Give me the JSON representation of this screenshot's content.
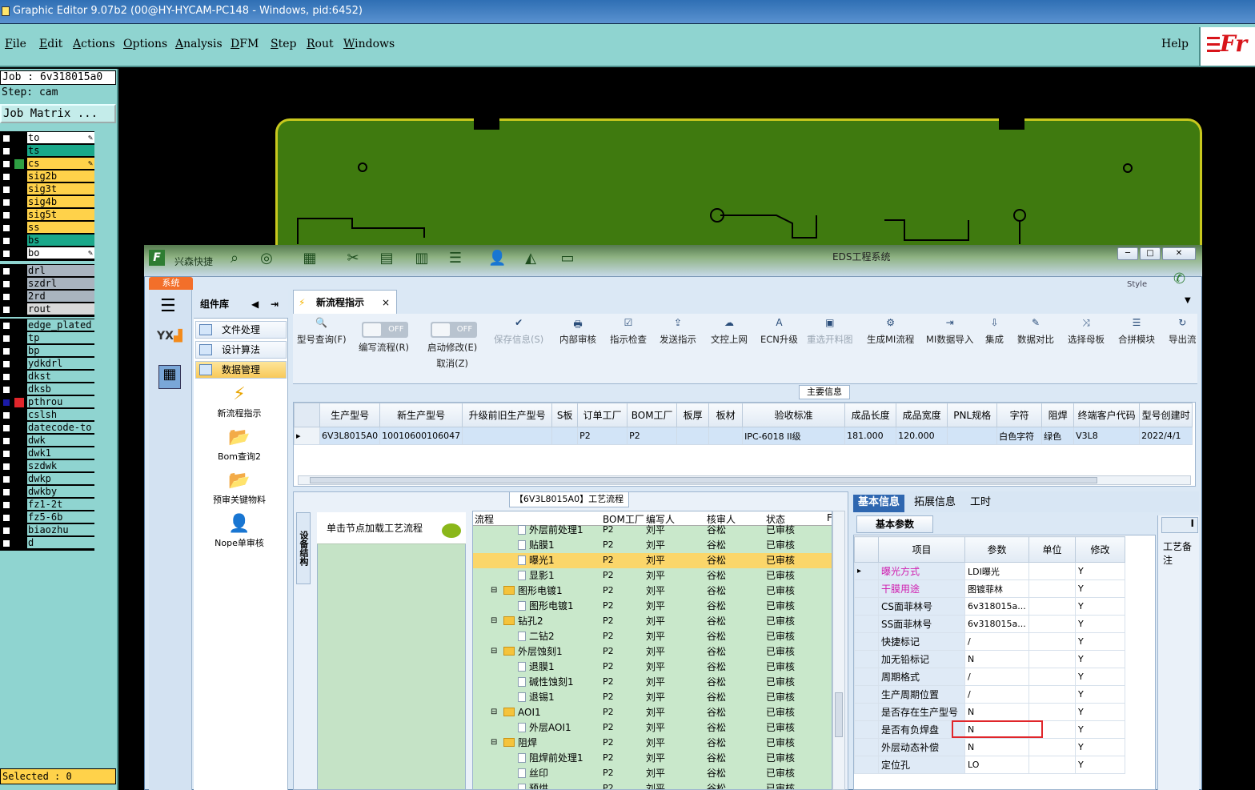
{
  "window": {
    "title": "Graphic Editor 9.07b2 (00@HY-HYCAM-PC148 - Windows, pid:6452)"
  },
  "menu": {
    "items": [
      "File",
      "Edit",
      "Actions",
      "Options",
      "Analysis",
      "DFM",
      "Step",
      "Rout",
      "Windows"
    ],
    "help": "Help",
    "logo": "Fr"
  },
  "left": {
    "job": "Job : 6v318015a0",
    "step": "Step: cam",
    "matrix_button": "Job Matrix ...",
    "layers_group1": [
      {
        "name": "to",
        "color": "#ffffff",
        "pen": true
      },
      {
        "name": "ts",
        "color": "#1aa88a"
      },
      {
        "name": "cs",
        "color": "#ffd24a",
        "pen": true,
        "mark": "#2ea043"
      },
      {
        "name": "sig2b",
        "color": "#ffd24a"
      },
      {
        "name": "sig3t",
        "color": "#ffd24a"
      },
      {
        "name": "sig4b",
        "color": "#ffd24a"
      },
      {
        "name": "sig5t",
        "color": "#ffd24a"
      },
      {
        "name": "ss",
        "color": "#ffd24a"
      },
      {
        "name": "bs",
        "color": "#1aa88a"
      },
      {
        "name": "bo",
        "color": "#ffffff",
        "pen": true
      }
    ],
    "layers_group2": [
      {
        "name": "drl",
        "color": "#a9b4bf"
      },
      {
        "name": "szdrl",
        "color": "#a9b4bf"
      },
      {
        "name": "2rd",
        "color": "#a9b4bf"
      },
      {
        "name": "rout",
        "color": "#d9d9d9"
      }
    ],
    "layers_group3": [
      {
        "name": "edge_plated",
        "color": "#8fd4d0"
      },
      {
        "name": "tp",
        "color": "#8fd4d0"
      },
      {
        "name": "bp",
        "color": "#8fd4d0"
      },
      {
        "name": "ydkdrl",
        "color": "#8fd4d0"
      },
      {
        "name": "dkst",
        "color": "#8fd4d0"
      },
      {
        "name": "dksb",
        "color": "#8fd4d0"
      },
      {
        "name": "pthrou",
        "color": "#8fd4d0",
        "mark": "#e0262b",
        "sel": true
      },
      {
        "name": "cslsh",
        "color": "#8fd4d0"
      },
      {
        "name": "datecode-to",
        "color": "#8fd4d0"
      },
      {
        "name": "dwk",
        "color": "#8fd4d0"
      },
      {
        "name": "dwk1",
        "color": "#8fd4d0"
      },
      {
        "name": "szdwk",
        "color": "#8fd4d0"
      },
      {
        "name": "dwkp",
        "color": "#8fd4d0"
      },
      {
        "name": "dwkby",
        "color": "#8fd4d0"
      },
      {
        "name": "fz1-2t",
        "color": "#8fd4d0"
      },
      {
        "name": "fz5-6b",
        "color": "#8fd4d0"
      },
      {
        "name": "biaozhu",
        "color": "#8fd4d0"
      },
      {
        "name": "d",
        "color": "#8fd4d0"
      }
    ],
    "selected": "Selected : 0"
  },
  "eds": {
    "app_name": "兴森快捷",
    "title": "EDS工程系统",
    "style_label": "Style",
    "sys_tab": "系统",
    "component_lib": "组件库",
    "comp_items": [
      "文件处理",
      "设计算法",
      "数据管理"
    ],
    "tools": [
      {
        "label": "新流程指示",
        "icon": "⚡"
      },
      {
        "label": "Bom查询2",
        "icon": "📂"
      },
      {
        "label": "预审关键物料",
        "icon": "📂"
      },
      {
        "label": "Nope单审核",
        "icon": "👤"
      }
    ],
    "doc_tab": "新流程指示",
    "ribbon": [
      {
        "label": "型号查询(F)",
        "icon": "🔍"
      },
      {
        "label": "编写流程(R)",
        "toggle": "OFF"
      },
      {
        "label": "启动修改(E)",
        "label2": "取消(Z)",
        "toggle": "OFF"
      },
      {
        "label": "保存信息(S)",
        "icon": "✔",
        "disabled": true
      },
      {
        "label": "内部审核",
        "icon": "🖶"
      },
      {
        "label": "指示检查",
        "icon": "☑"
      },
      {
        "label": "发送指示",
        "icon": "⇪"
      },
      {
        "label": "文控上网",
        "icon": "☁"
      },
      {
        "label": "ECN升级",
        "icon": "A"
      },
      {
        "label": "重选开料图",
        "icon": "▣",
        "disabled": true
      },
      {
        "label": "生成MI流程",
        "icon": "⚙"
      },
      {
        "label": "MI数据导入",
        "icon": "⇥"
      },
      {
        "label": "集成",
        "icon": "⇩"
      },
      {
        "label": "数据对比",
        "icon": "✎"
      },
      {
        "label": "选择母板",
        "icon": "⤨"
      },
      {
        "label": "合拼模块",
        "icon": "☰"
      },
      {
        "label": "导出流",
        "icon": "↻"
      }
    ],
    "main_info_label": "主要信息",
    "main_table": {
      "headers": [
        "生产型号",
        "新生产型号",
        "升级前旧生产型号",
        "S板",
        "订单工厂",
        "BOM工厂",
        "板厚",
        "板材",
        "验收标准",
        "成品长度",
        "成品宽度",
        "PNL规格",
        "字符",
        "阻焊",
        "终端客户代码",
        "型号创建时"
      ],
      "row": [
        "6V3L8015A0",
        "10010600106047",
        "",
        "",
        "P2",
        "P2",
        "",
        "",
        "IPC-6018 II级",
        "181.000",
        "120.000",
        "",
        "白色字符",
        "绿色",
        "V3L8",
        "2022/4/1"
      ]
    },
    "process_title": "【6V3L8015A0】工艺流程",
    "equipment_tab": "设备结构",
    "node_hint": "单击节点加载工艺流程",
    "tree_headers": [
      "流程",
      "BOM工厂",
      "编写人",
      "核审人",
      "状态",
      "F"
    ],
    "tree_rows": [
      {
        "name": "外层前处理1",
        "type": "doc",
        "lvl": 2,
        "f": "P2",
        "w": "刘平",
        "a": "谷松",
        "s": "已审核"
      },
      {
        "name": "贴膜1",
        "type": "doc",
        "lvl": 2,
        "f": "P2",
        "w": "刘平",
        "a": "谷松",
        "s": "已审核"
      },
      {
        "name": "曝光1",
        "type": "doc",
        "lvl": 2,
        "f": "P2",
        "w": "刘平",
        "a": "谷松",
        "s": "已审核",
        "hl": true
      },
      {
        "name": "显影1",
        "type": "doc",
        "lvl": 2,
        "f": "P2",
        "w": "刘平",
        "a": "谷松",
        "s": "已审核"
      },
      {
        "name": "图形电镀1",
        "type": "fold",
        "lvl": 1,
        "f": "P2",
        "w": "刘平",
        "a": "谷松",
        "s": "已审核"
      },
      {
        "name": "图形电镀1",
        "type": "doc",
        "lvl": 2,
        "f": "P2",
        "w": "刘平",
        "a": "谷松",
        "s": "已审核"
      },
      {
        "name": "钻孔2",
        "type": "fold",
        "lvl": 1,
        "f": "P2",
        "w": "刘平",
        "a": "谷松",
        "s": "已审核"
      },
      {
        "name": "二钻2",
        "type": "doc",
        "lvl": 2,
        "f": "P2",
        "w": "刘平",
        "a": "谷松",
        "s": "已审核"
      },
      {
        "name": "外层蚀刻1",
        "type": "fold",
        "lvl": 1,
        "f": "P2",
        "w": "刘平",
        "a": "谷松",
        "s": "已审核"
      },
      {
        "name": "退膜1",
        "type": "doc",
        "lvl": 2,
        "f": "P2",
        "w": "刘平",
        "a": "谷松",
        "s": "已审核"
      },
      {
        "name": "碱性蚀刻1",
        "type": "doc",
        "lvl": 2,
        "f": "P2",
        "w": "刘平",
        "a": "谷松",
        "s": "已审核"
      },
      {
        "name": "退锡1",
        "type": "doc",
        "lvl": 2,
        "f": "P2",
        "w": "刘平",
        "a": "谷松",
        "s": "已审核"
      },
      {
        "name": "AOI1",
        "type": "fold",
        "lvl": 1,
        "f": "P2",
        "w": "刘平",
        "a": "谷松",
        "s": "已审核"
      },
      {
        "name": "外层AOI1",
        "type": "doc",
        "lvl": 2,
        "f": "P2",
        "w": "刘平",
        "a": "谷松",
        "s": "已审核"
      },
      {
        "name": "阻焊",
        "type": "fold",
        "lvl": 1,
        "f": "P2",
        "w": "刘平",
        "a": "谷松",
        "s": "已审核"
      },
      {
        "name": "阻焊前处理1",
        "type": "doc",
        "lvl": 2,
        "f": "P2",
        "w": "刘平",
        "a": "谷松",
        "s": "已审核"
      },
      {
        "name": "丝印",
        "type": "doc",
        "lvl": 2,
        "f": "P2",
        "w": "刘平",
        "a": "谷松",
        "s": "已审核"
      },
      {
        "name": "预烘",
        "type": "doc",
        "lvl": 2,
        "f": "P2",
        "w": "刘平",
        "a": "谷松",
        "s": "已审核"
      }
    ],
    "param_tabs": [
      "基本信息",
      "拓展信息",
      "工时"
    ],
    "basic_params": "基本参数",
    "param_headers": [
      "项目",
      "参数",
      "单位",
      "修改"
    ],
    "params": [
      {
        "k": "曝光方式",
        "v": "LDI曝光",
        "m": "Y",
        "pink": true
      },
      {
        "k": "干膜用途",
        "v": "图镀菲林",
        "m": "Y",
        "pink": true
      },
      {
        "k": "CS面菲林号",
        "v": "6v318015a...",
        "m": "Y"
      },
      {
        "k": "SS面菲林号",
        "v": "6v318015a...",
        "m": "Y"
      },
      {
        "k": "快捷标记",
        "v": "/",
        "m": "Y"
      },
      {
        "k": "加无铅标记",
        "v": "N",
        "m": "Y"
      },
      {
        "k": "周期格式",
        "v": "/",
        "m": "Y"
      },
      {
        "k": "生产周期位置",
        "v": "/",
        "m": "Y"
      },
      {
        "k": "是否存在生产型号",
        "v": "N",
        "m": "Y"
      },
      {
        "k": "是否有负焊盘",
        "v": "N",
        "m": "Y"
      },
      {
        "k": "外层动态补偿",
        "v": "N",
        "m": "Y"
      },
      {
        "k": "定位孔",
        "v": "LO",
        "m": "Y"
      }
    ],
    "right_tab": "I",
    "right_label": "工艺备注"
  }
}
